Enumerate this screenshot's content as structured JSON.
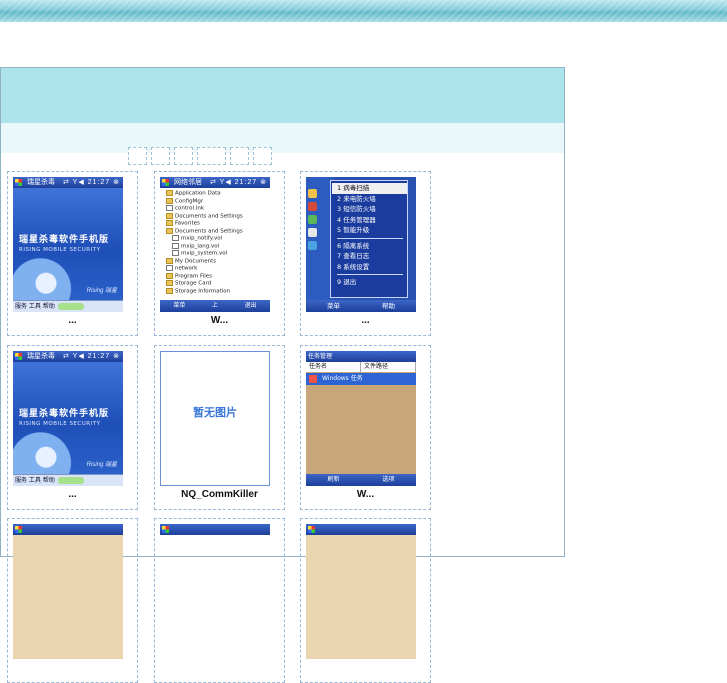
{
  "pager_count": 6,
  "gallery": [
    {
      "caption": "...",
      "screen": "splash",
      "splash": {
        "status_title": "瑞星杀毒",
        "status_icons": "⇄ Y◀ 21:27 ⊗",
        "title": "瑞星杀毒软件手机版",
        "subtitle": "RISING MOBILE SECURITY",
        "brand": "Rising 瑞星",
        "bottom": "服务 工具 帮助"
      }
    },
    {
      "caption": "W...",
      "screen": "explorer",
      "explorer": {
        "status_title": "网络邻居",
        "status_icons": "⇄ Y◀ 21:27 ⊗",
        "rows": [
          "Application Data",
          "ConfigMgr",
          "control.lnk",
          "Documents and Settings",
          "Favorites",
          "Documents and Settings",
          "mxip_notify.vol",
          "mxip_lang.vol",
          "mxip_system.vol",
          "My Documents",
          "network",
          "Program Files",
          "Storage Card",
          "Storage Information",
          "Temp",
          "Windows"
        ],
        "soft_left": "菜单",
        "soft_mid": "上",
        "soft_right": "退出"
      }
    },
    {
      "caption": "...",
      "screen": "menu",
      "menu": {
        "items": [
          "1 病毒扫描",
          "2 来电防火墙",
          "3 短信防火墙",
          "4 任务管理器",
          "5 智能升级",
          "6 隔离系统",
          "7 查看日志",
          "8 系统设置",
          "9 退出"
        ],
        "soft_left": "菜单",
        "soft_right": "帮助"
      }
    },
    {
      "caption": "...",
      "screen": "splash",
      "splash": {
        "status_title": "瑞星杀毒",
        "status_icons": "⇄ Y◀ 21:27 ⊗",
        "title": "瑞星杀毒软件手机版",
        "subtitle": "RISING MOBILE SECURITY",
        "brand": "Rising 瑞星",
        "bottom": "服务 工具 帮助"
      }
    },
    {
      "caption": "NQ_CommKiller",
      "screen": "noimage",
      "noimage": {
        "text": "暂无图片"
      }
    },
    {
      "caption": "W...",
      "screen": "tasks",
      "tasks": {
        "title": "任务管理",
        "col1": "任务名",
        "col2": "文件路径",
        "selected": "Windows 任务",
        "soft_left": "刷新",
        "soft_right": "选项"
      }
    }
  ]
}
